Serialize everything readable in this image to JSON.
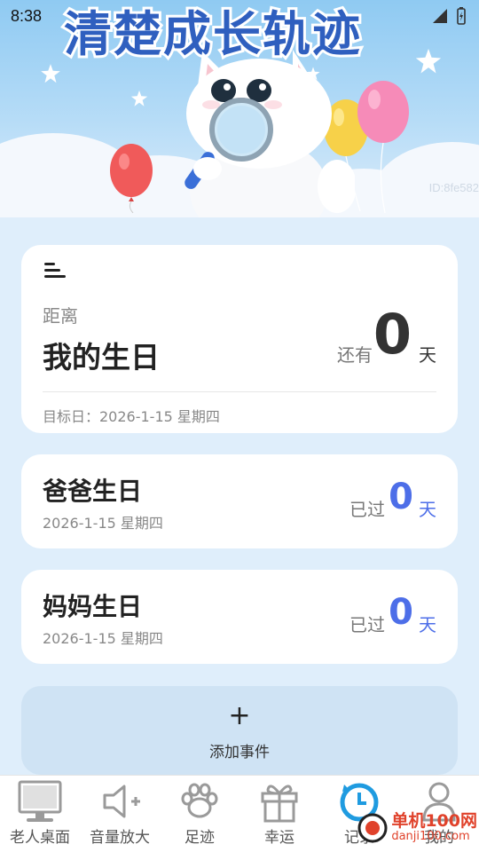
{
  "status_bar": {
    "time": "8:38"
  },
  "banner": {
    "title": "清楚成长轨迹",
    "id_text": "ID:8fe582"
  },
  "main_card": {
    "distance_label": "距离",
    "event_title": "我的生日",
    "remain_prefix": "还有",
    "remain_count": "0",
    "remain_unit": "天",
    "target_date": "目标日：2026-1-15 星期四"
  },
  "events": [
    {
      "title": "爸爸生日",
      "date": "2026-1-15 星期四",
      "prefix": "已过",
      "count": "0",
      "unit": "天"
    },
    {
      "title": "妈妈生日",
      "date": "2026-1-15 星期四",
      "prefix": "已过",
      "count": "0",
      "unit": "天"
    }
  ],
  "add_event": {
    "plus": "+",
    "label": "添加事件"
  },
  "bottom_nav": {
    "items": [
      {
        "label": "老人桌面",
        "icon": "monitor-icon"
      },
      {
        "label": "音量放大",
        "icon": "speaker-icon"
      },
      {
        "label": "足迹",
        "icon": "paw-icon"
      },
      {
        "label": "幸运",
        "icon": "gift-icon"
      },
      {
        "label": "记录",
        "icon": "clock-icon",
        "active": true
      },
      {
        "label": "我的",
        "icon": "person-icon"
      }
    ]
  },
  "watermark": {
    "text": "单机100网",
    "sub": "danji100.com"
  },
  "colors": {
    "accent": "#4d6ee8",
    "banner_title": "#2f5fbf",
    "active_nav": "#1f9be0",
    "background": "#dfeefb"
  }
}
